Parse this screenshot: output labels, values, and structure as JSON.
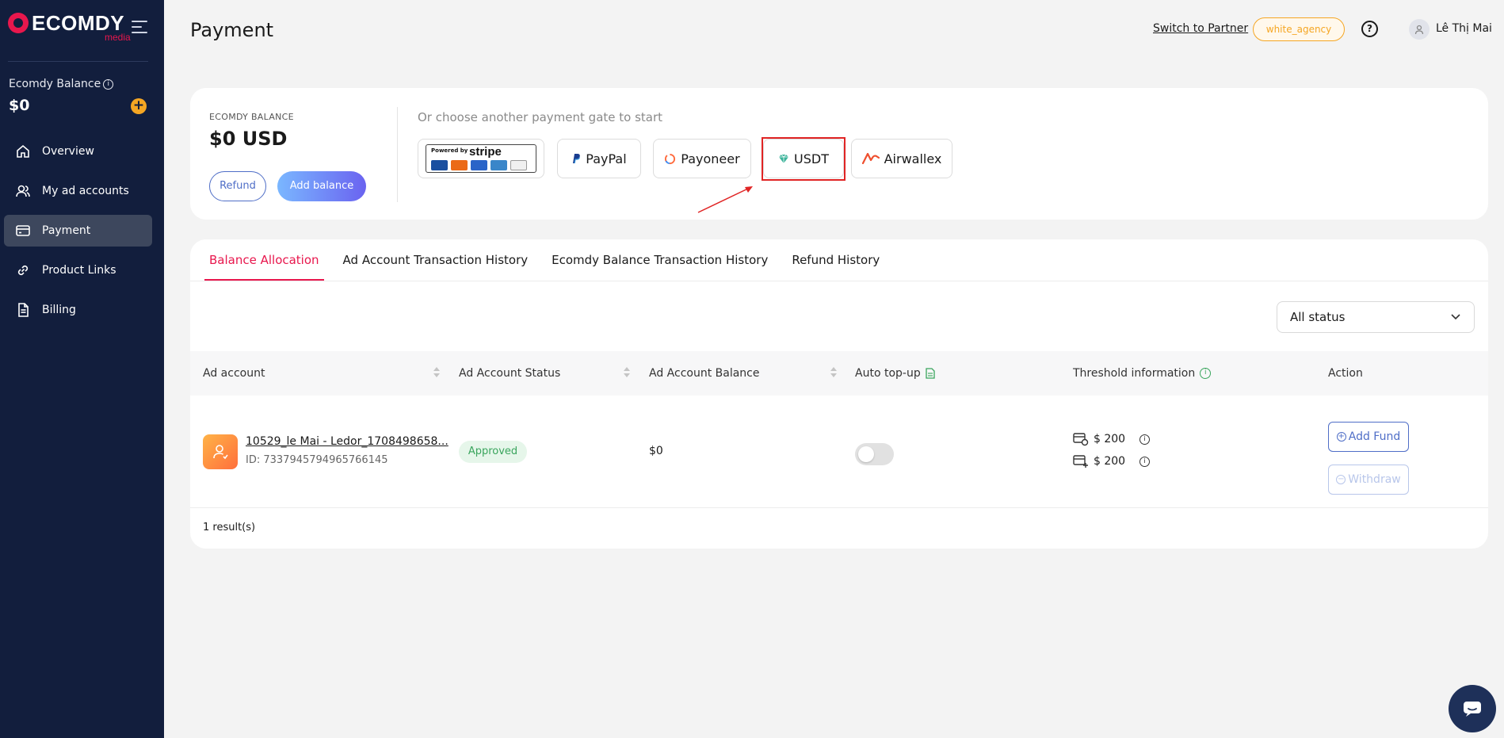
{
  "brand": {
    "logo_text": "ECOMDY",
    "logo_sub": "media"
  },
  "sidebar": {
    "balance_label": "Ecomdy Balance",
    "balance_amount": "$0",
    "items": [
      {
        "label": "Overview",
        "icon": "home-icon"
      },
      {
        "label": "My ad accounts",
        "icon": "users-icon"
      },
      {
        "label": "Payment",
        "icon": "card-icon",
        "active": true
      },
      {
        "label": "Product Links",
        "icon": "link-icon"
      },
      {
        "label": "Billing",
        "icon": "document-icon"
      }
    ]
  },
  "header": {
    "title": "Payment",
    "switch_link": "Switch to Partner",
    "agency_badge": "white_agency",
    "user_name": "Lê Thị Mai"
  },
  "balance_card": {
    "label": "ECOMDY BALANCE",
    "amount": "$0 USD",
    "refund_label": "Refund",
    "add_balance_label": "Add balance",
    "gate_title": "Or choose another payment gate to start",
    "stripe_powered": "Powered by",
    "stripe_name": "stripe",
    "gates": [
      "PayPal",
      "Payoneer",
      "USDT",
      "Airwallex"
    ],
    "highlight": "USDT"
  },
  "tabs": [
    "Balance Allocation",
    "Ad Account Transaction History",
    "Ecomdy Balance Transaction History",
    "Refund History"
  ],
  "filter": {
    "status_value": "All status"
  },
  "table": {
    "columns": [
      "Ad account",
      "Ad Account Status",
      "Ad Account Balance",
      "Auto top-up",
      "Threshold information",
      "Action"
    ],
    "rows": [
      {
        "name": "10529_le Mai - Ledor_1708498658...",
        "id": "ID: 7337945794965766145",
        "status": "Approved",
        "balance": "$0",
        "auto_topup": false,
        "threshold_1": "$ 200",
        "threshold_2": "$ 200",
        "add_fund": "Add Fund",
        "withdraw": "Withdraw"
      }
    ],
    "results": "1 result(s)"
  },
  "colors": {
    "accent": "#e8174d",
    "sidebar_bg": "#121e3d",
    "link_blue": "#4f6ec7"
  }
}
